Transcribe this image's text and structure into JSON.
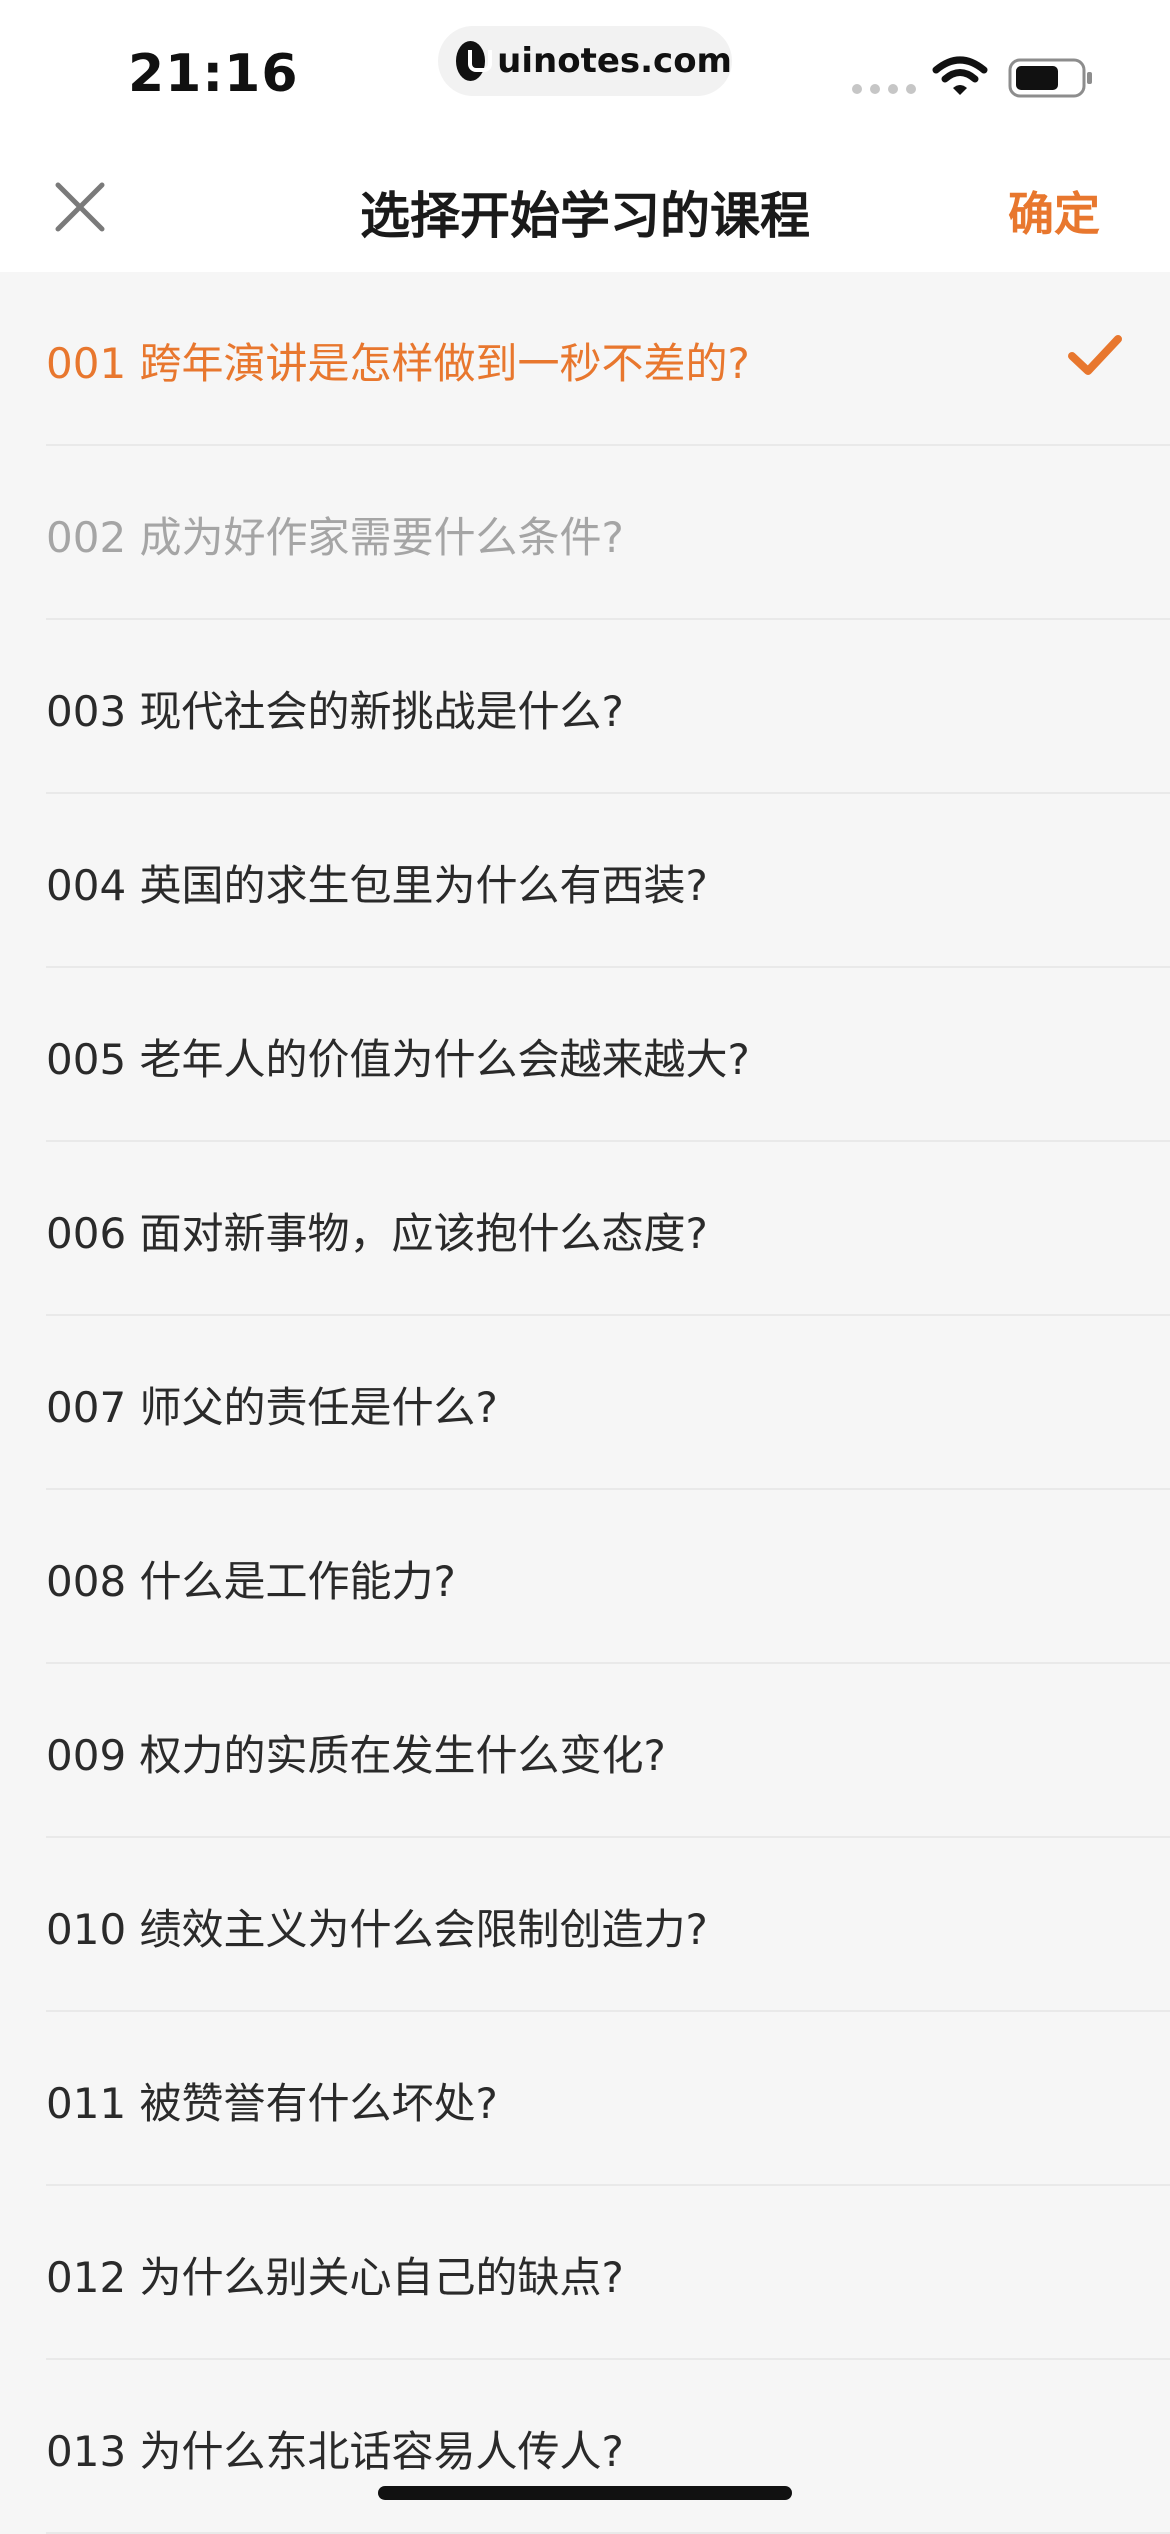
{
  "status_bar": {
    "time": "21:16",
    "url": "uinotes.com"
  },
  "nav": {
    "title": "选择开始学习的课程",
    "confirm_label": "确定",
    "close_icon": "close-icon"
  },
  "colors": {
    "accent": "#e8772e",
    "disabled_text": "#a5a5a5",
    "text": "#2a2a2a",
    "background": "#f6f6f6"
  },
  "courses": [
    {
      "label": "001 跨年演讲是怎样做到一秒不差的?",
      "state": "selected"
    },
    {
      "label": "002 成为好作家需要什么条件?",
      "state": "disabled"
    },
    {
      "label": "003 现代社会的新挑战是什么?",
      "state": "normal"
    },
    {
      "label": "004 英国的求生包里为什么有西装?",
      "state": "normal"
    },
    {
      "label": "005 老年人的价值为什么会越来越大?",
      "state": "normal"
    },
    {
      "label": "006 面对新事物，应该抱什么态度?",
      "state": "normal"
    },
    {
      "label": "007 师父的责任是什么?",
      "state": "normal"
    },
    {
      "label": "008 什么是工作能力?",
      "state": "normal"
    },
    {
      "label": "009 权力的实质在发生什么变化?",
      "state": "normal"
    },
    {
      "label": "010 绩效主义为什么会限制创造力?",
      "state": "normal"
    },
    {
      "label": "011 被赞誉有什么坏处?",
      "state": "normal"
    },
    {
      "label": "012 为什么别关心自己的缺点?",
      "state": "normal"
    },
    {
      "label": "013 为什么东北话容易人传人?",
      "state": "normal"
    }
  ]
}
